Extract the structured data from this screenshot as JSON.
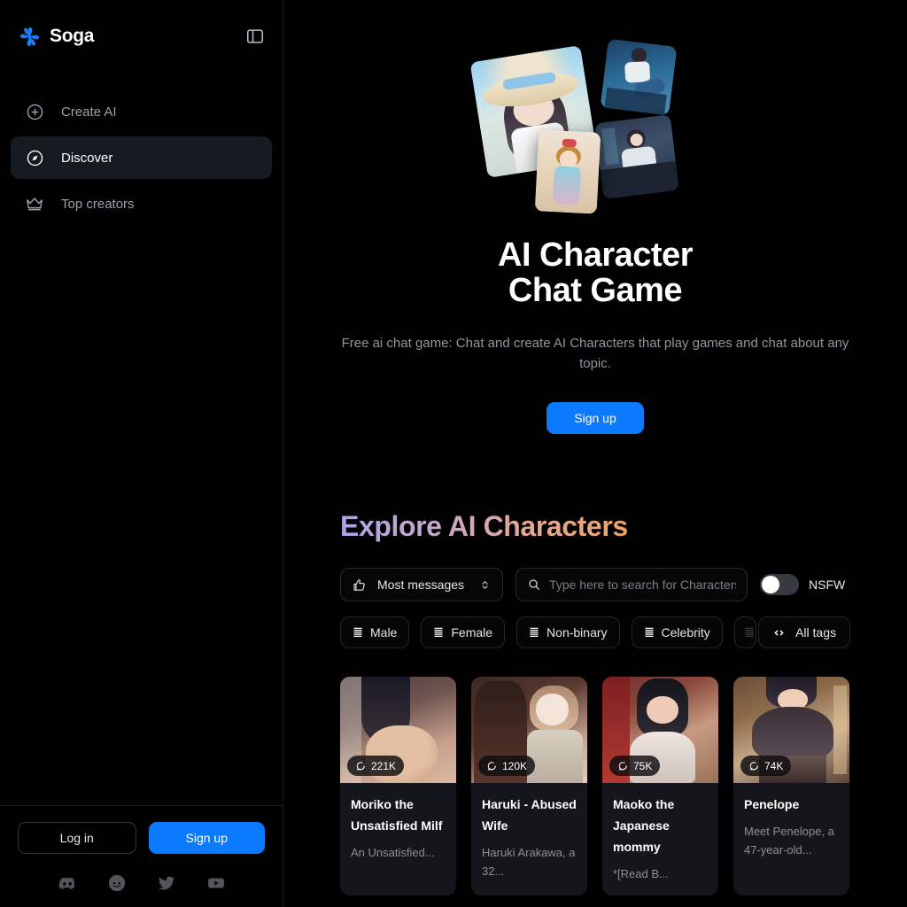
{
  "brand": {
    "name": "Soga",
    "logo_icon": "flower-pinwheel-icon",
    "accent": "#0b7afc"
  },
  "sidebar": {
    "panel_toggle_icon": "sidebar-panel-icon",
    "items": [
      {
        "label": "Create AI",
        "icon": "plus-circle-icon",
        "active": false
      },
      {
        "label": "Discover",
        "icon": "compass-icon",
        "active": true
      },
      {
        "label": "Top creators",
        "icon": "crown-icon",
        "active": false
      }
    ],
    "auth": {
      "login_label": "Log in",
      "signup_label": "Sign up"
    },
    "socials": [
      {
        "name": "discord-icon"
      },
      {
        "name": "reddit-icon"
      },
      {
        "name": "twitter-icon"
      },
      {
        "name": "youtube-icon"
      }
    ]
  },
  "hero": {
    "title_line1": "AI Character",
    "title_line2": "Chat Game",
    "subtitle": "Free ai chat game: Chat and create AI Characters that play games and chat about any topic.",
    "cta_label": "Sign up",
    "collage": [
      {
        "name": "hero-card-beach-hat-girl"
      },
      {
        "name": "hero-card-fighter-man"
      },
      {
        "name": "hero-card-office-girl"
      },
      {
        "name": "hero-card-desert-princess"
      }
    ]
  },
  "explore": {
    "heading": "Explore AI Characters",
    "sort": {
      "label": "Most messages",
      "icon": "thumbs-up-icon",
      "chevron": "chevron-up-down-icon"
    },
    "search": {
      "value": "",
      "placeholder": "Type here to search for Characters",
      "icon": "search-icon"
    },
    "nsfw": {
      "label": "NSFW",
      "enabled": false
    },
    "tags": [
      {
        "label": "Male",
        "icon": "list-stripes-icon"
      },
      {
        "label": "Female",
        "icon": "list-stripes-icon"
      },
      {
        "label": "Non-binary",
        "icon": "list-stripes-icon"
      },
      {
        "label": "Celebrity",
        "icon": "list-stripes-icon"
      },
      {
        "label": "",
        "icon": "list-stripes-icon"
      }
    ],
    "all_tags": {
      "label": "All tags",
      "icon": "code-brackets-icon"
    },
    "cards": [
      {
        "name": "Moriko the Unsatisfied Milf",
        "desc": "An Unsatisfied...",
        "messages": "221K",
        "messages_icon": "speech-bubble-icon"
      },
      {
        "name": "Haruki - Abused Wife",
        "desc": "Haruki Arakawa, a 32...",
        "messages": "120K",
        "messages_icon": "speech-bubble-icon"
      },
      {
        "name": "Maoko the Japanese mommy",
        "desc": "*[Read B...",
        "messages": "75K",
        "messages_icon": "speech-bubble-icon"
      },
      {
        "name": "Penelope",
        "desc": "Meet Penelope, a 47-year-old...",
        "messages": "74K",
        "messages_icon": "speech-bubble-icon"
      }
    ]
  }
}
